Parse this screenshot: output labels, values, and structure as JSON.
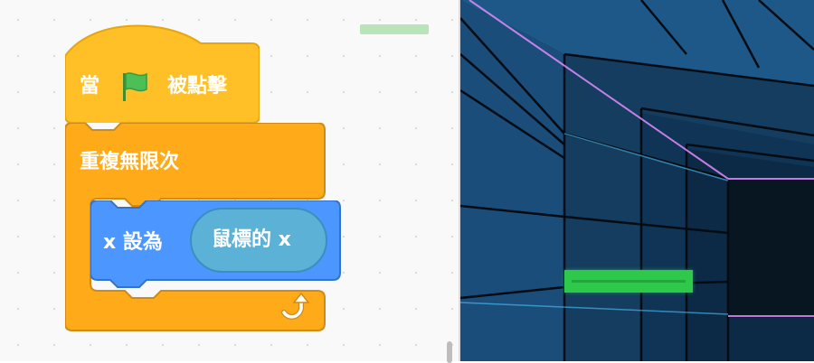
{
  "workspace": {
    "hat_block": {
      "prefix": "當",
      "suffix": "被點擊",
      "icon": "green-flag-icon",
      "color": "#ffbf26"
    },
    "forever_block": {
      "label": "重複無限次",
      "icon": "loop-arrow-icon",
      "color": "#ffab19"
    },
    "set_block": {
      "label": "x 設為",
      "color": "#4c97ff",
      "reporter": {
        "label": "鼠標的 x",
        "color": "#5cb1d6"
      }
    }
  },
  "stage": {
    "colors": {
      "wall": "#1a4d7a",
      "edge_glow": "#e58bff",
      "paddle": "#2ec94a"
    },
    "sprites": [
      "paddle"
    ]
  }
}
